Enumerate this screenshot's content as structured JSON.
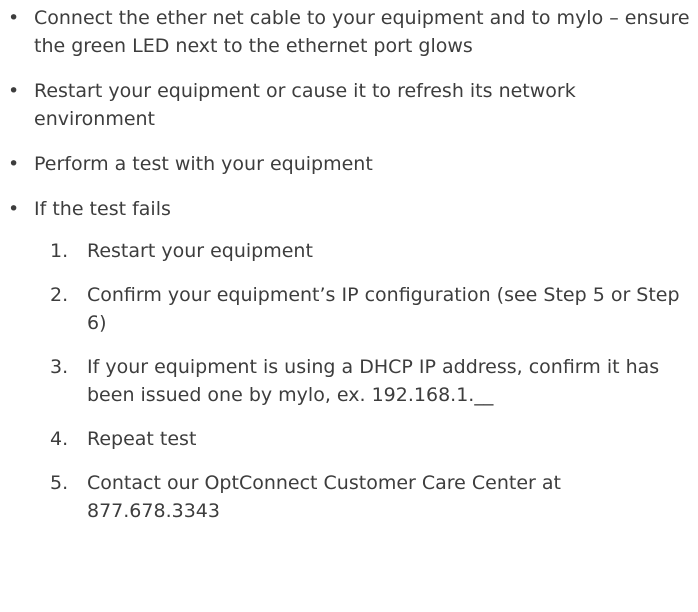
{
  "bullets": [
    {
      "marker": "•",
      "text": "Connect the ether net cable to your equipment and to mylo – ensure the green LED next to the ethernet port glows"
    },
    {
      "marker": "•",
      "text": "Restart your equipment or cause it to refresh its network environment"
    },
    {
      "marker": "•",
      "text": "Perform a test with your equipment"
    },
    {
      "marker": "•",
      "text": "If the test fails"
    }
  ],
  "steps": [
    {
      "marker": "1.",
      "text": "Restart your equipment"
    },
    {
      "marker": "2.",
      "text": "Confirm your equipment’s IP configuration (see Step 5 or Step 6)"
    },
    {
      "marker": "3.",
      "text": "If your equipment is using a DHCP IP address, confirm it has been issued one by  mylo, ex. 192.168.1.__"
    },
    {
      "marker": "4.",
      "text": "Repeat test"
    },
    {
      "marker": "5.",
      "text": "Contact our OptConnect Customer Care Center at 877.678.3343"
    }
  ]
}
